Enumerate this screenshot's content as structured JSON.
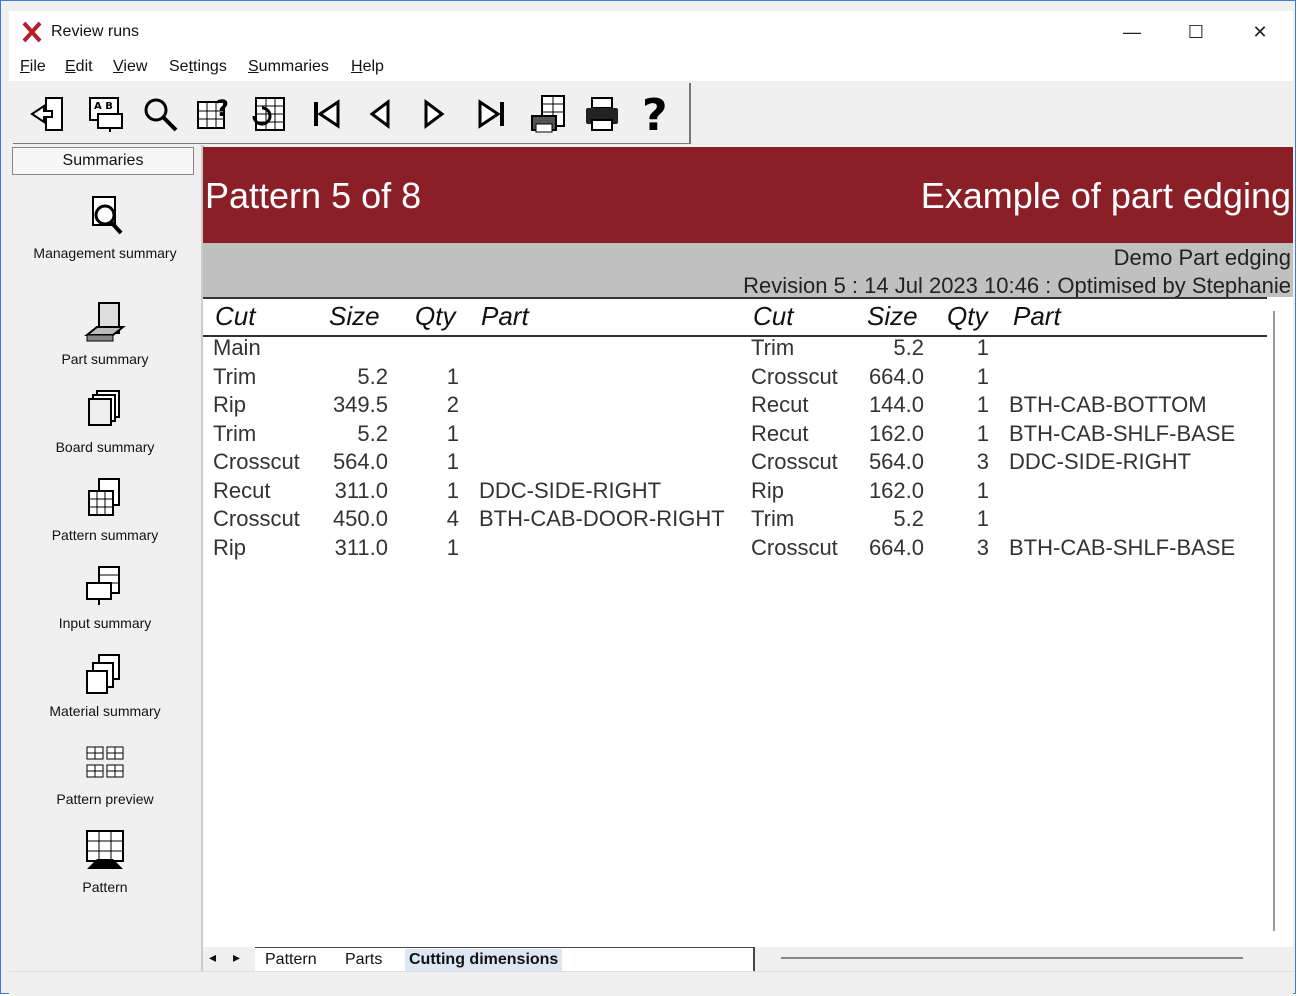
{
  "window": {
    "title": "Review runs",
    "minimize": "—",
    "maximize": "☐",
    "close": "✕"
  },
  "menu": [
    {
      "first": "F",
      "rest": "ile"
    },
    {
      "first": "E",
      "rest": "dit"
    },
    {
      "first": "V",
      "rest": "iew"
    },
    {
      "first": "Se",
      "ul": "t",
      "rest": "tings",
      "mid": true
    },
    {
      "first": "S",
      "rest": "ummaries"
    },
    {
      "first": "H",
      "rest": "elp"
    }
  ],
  "toolbar": {
    "icons": [
      "exit-icon",
      "labels-icon",
      "search-icon",
      "query-icon",
      "refresh-grid-icon",
      "first-icon",
      "previous-icon",
      "next-icon",
      "last-icon",
      "print-preview-icon",
      "print-icon",
      "help-icon"
    ]
  },
  "sidebar": {
    "header": "Summaries",
    "items": [
      {
        "label": "Management summary",
        "icon": "management-summary-icon"
      },
      {
        "label": "Part summary",
        "icon": "part-summary-icon"
      },
      {
        "label": "Board summary",
        "icon": "board-summary-icon"
      },
      {
        "label": "Pattern summary",
        "icon": "pattern-summary-icon"
      },
      {
        "label": "Input summary",
        "icon": "input-summary-icon"
      },
      {
        "label": "Material summary",
        "icon": "material-summary-icon"
      },
      {
        "label": "Pattern preview",
        "icon": "pattern-preview-icon"
      },
      {
        "label": "Pattern",
        "icon": "pattern-icon"
      }
    ]
  },
  "report": {
    "pattern_title": "Pattern 5 of 8",
    "job_title": "Example of part edging",
    "line1": "Demo Part edging",
    "line2": "Revision 5 : 14 Jul 2023 10:46 : Optimised by Stephanie",
    "headers": [
      "Cut",
      "Size",
      "Qty",
      "Part"
    ],
    "left_rows": [
      {
        "cut": "Main",
        "size": "",
        "qty": "",
        "part": ""
      },
      {
        "cut": "Trim",
        "size": "5.2",
        "qty": "1",
        "part": ""
      },
      {
        "cut": "Rip",
        "size": "349.5",
        "qty": "2",
        "part": ""
      },
      {
        "cut": "Trim",
        "size": "5.2",
        "qty": "1",
        "part": ""
      },
      {
        "cut": "Crosscut",
        "size": "564.0",
        "qty": "1",
        "part": ""
      },
      {
        "cut": "Recut",
        "size": "311.0",
        "qty": "1",
        "part": "DDC-SIDE-RIGHT"
      },
      {
        "cut": "Crosscut",
        "size": "450.0",
        "qty": "4",
        "part": "BTH-CAB-DOOR-RIGHT"
      },
      {
        "cut": "Rip",
        "size": "311.0",
        "qty": "1",
        "part": ""
      }
    ],
    "right_rows": [
      {
        "cut": "Trim",
        "size": "5.2",
        "qty": "1",
        "part": ""
      },
      {
        "cut": "Crosscut",
        "size": "664.0",
        "qty": "1",
        "part": ""
      },
      {
        "cut": "Recut",
        "size": "144.0",
        "qty": "1",
        "part": "BTH-CAB-BOTTOM"
      },
      {
        "cut": "Recut",
        "size": "162.0",
        "qty": "1",
        "part": "BTH-CAB-SHLF-BASE"
      },
      {
        "cut": "Crosscut",
        "size": "564.0",
        "qty": "3",
        "part": "DDC-SIDE-RIGHT"
      },
      {
        "cut": "Rip",
        "size": "162.0",
        "qty": "1",
        "part": ""
      },
      {
        "cut": "Trim",
        "size": "5.2",
        "qty": "1",
        "part": ""
      },
      {
        "cut": "Crosscut",
        "size": "664.0",
        "qty": "3",
        "part": "BTH-CAB-SHLF-BASE"
      }
    ]
  },
  "tabs": {
    "items": [
      "Pattern",
      "Parts",
      "Cutting dimensions"
    ],
    "active": "Cutting dimensions",
    "nav_left": "◂",
    "nav_right": "▸"
  },
  "colors": {
    "banner": "#8b1f27",
    "info": "#c0c0c0",
    "accent_border": "#3a7bd5"
  }
}
